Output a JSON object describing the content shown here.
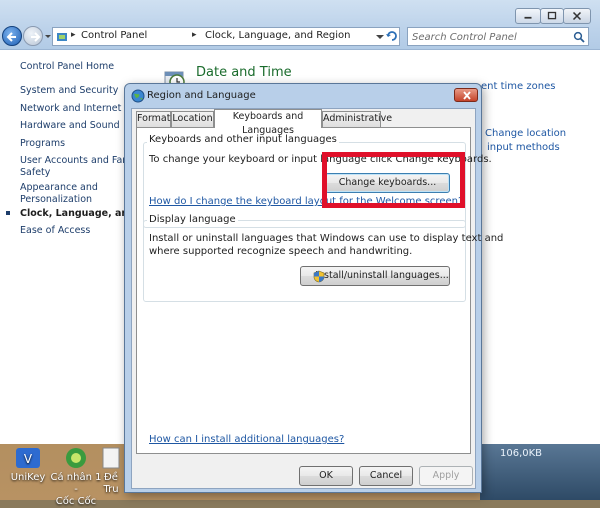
{
  "address_bar": {
    "crumbs": [
      "Control Panel",
      "Clock, Language, and Region"
    ]
  },
  "search": {
    "placeholder": "Search Control Panel"
  },
  "nav_pane": {
    "home": "Control Panel Home",
    "items": [
      "System and Security",
      "Network and Internet",
      "Hardware and Sound",
      "Programs",
      "User Accounts and Family",
      "Safety",
      "Appearance and",
      "Personalization",
      "Clock, Language, and Reg",
      "Ease of Access"
    ]
  },
  "content": {
    "heading": "Date and Time",
    "links": [
      "ent time zones",
      "Change location",
      "input methods"
    ]
  },
  "dialog": {
    "title": "Region and Language",
    "tabs": [
      "Formats",
      "Location",
      "Keyboards and Languages",
      "Administrative"
    ],
    "active_tab": "Keyboards and Languages",
    "keyboards_group": {
      "label": "Keyboards and other input languages",
      "description": "To change your keyboard or input language click Change keyboards.",
      "button": "Change keyboards...",
      "help_link": "How do I change the keyboard layout for the Welcome screen?"
    },
    "display_group": {
      "label": "Display language",
      "description_line1": "Install or uninstall languages that Windows can use to display text and",
      "description_line2": "where supported recognize speech and handwriting.",
      "button": "Install/uninstall languages..."
    },
    "bottom_link": "How can I install additional languages?",
    "buttons": {
      "ok": "OK",
      "cancel": "Cancel",
      "apply": "Apply"
    }
  },
  "desktop": {
    "icons": [
      "UniKey",
      "Cá nhân 1 -",
      "Cốc Cốc",
      "Đề",
      "Tru"
    ]
  },
  "tray": {
    "text": "106,0KB"
  },
  "colors": {
    "highlight": "#e0102a",
    "link": "#1e57a3",
    "heading_green": "#1a6b2c"
  }
}
